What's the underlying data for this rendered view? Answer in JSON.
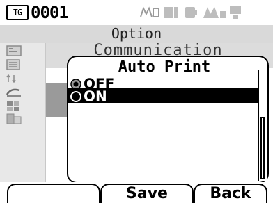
{
  "status": {
    "target_badge": "TG",
    "target_number": "0001",
    "icons": [
      "measurement-mode-icon",
      "sample-icon",
      "battery-icon",
      "signal-icon",
      "connection-icon"
    ]
  },
  "screen": {
    "title": "Option",
    "submenu": "Communication"
  },
  "dialog": {
    "title": "Auto Print",
    "options": [
      {
        "label": "OFF",
        "selected": true
      },
      {
        "label": "ON",
        "highlighted": true
      }
    ]
  },
  "softkeys": {
    "key1": "",
    "key2": "Save",
    "key3": "Back"
  },
  "sidebar": {
    "icons": [
      "display-setting-icon",
      "list-icon",
      "transfer-icon",
      "communication-icon",
      "language-icon",
      "other-setting-icon"
    ]
  }
}
